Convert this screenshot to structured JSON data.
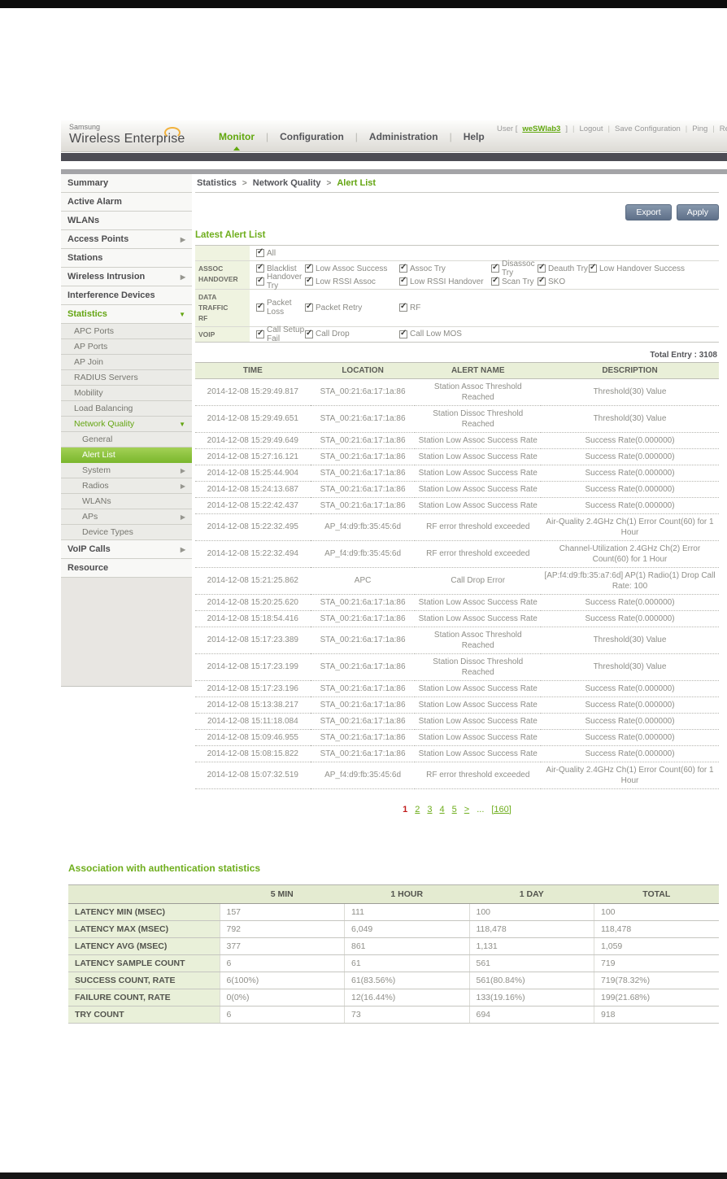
{
  "brand": {
    "company": "Samsung",
    "product": "Wireless Enterprise"
  },
  "topbar": {
    "user_prefix": "User [",
    "username": "weSWlab3",
    "user_suffix": "]",
    "separator": "|",
    "links": [
      "Logout",
      "Save Configuration",
      "Ping",
      "Refresh"
    ]
  },
  "nav": {
    "separator": "|",
    "items": [
      {
        "label": "Monitor",
        "active": true
      },
      {
        "label": "Configuration",
        "active": false
      },
      {
        "label": "Administration",
        "active": false
      },
      {
        "label": "Help",
        "active": false
      }
    ]
  },
  "sidebar": {
    "items": [
      {
        "label": "Summary",
        "level": 0
      },
      {
        "label": "Active Alarm",
        "level": 0
      },
      {
        "label": "WLANs",
        "level": 0
      },
      {
        "label": "Access Points",
        "level": 0,
        "arrow": "right"
      },
      {
        "label": "Stations",
        "level": 0
      },
      {
        "label": "Wireless Intrusion",
        "level": 0,
        "arrow": "right"
      },
      {
        "label": "Interference Devices",
        "level": 0
      },
      {
        "label": "Statistics",
        "level": 0,
        "arrow": "down",
        "green": true
      },
      {
        "label": "APC Ports",
        "level": 1
      },
      {
        "label": "AP Ports",
        "level": 1
      },
      {
        "label": "AP Join",
        "level": 1
      },
      {
        "label": "RADIUS Servers",
        "level": 1
      },
      {
        "label": "Mobility",
        "level": 1
      },
      {
        "label": "Load Balancing",
        "level": 1
      },
      {
        "label": "Network Quality",
        "level": 1,
        "arrow": "down",
        "green": true
      },
      {
        "label": "General",
        "level": 2
      },
      {
        "label": "Alert List",
        "level": 2,
        "selected": true
      },
      {
        "label": "System",
        "level": 2,
        "arrow": "right"
      },
      {
        "label": "Radios",
        "level": 2,
        "arrow": "right"
      },
      {
        "label": "WLANs",
        "level": 2
      },
      {
        "label": "APs",
        "level": 2,
        "arrow": "right"
      },
      {
        "label": "Device Types",
        "level": 2
      },
      {
        "label": "VoIP Calls",
        "level": 0,
        "arrow": "right"
      },
      {
        "label": "Resource",
        "level": 0
      }
    ]
  },
  "breadcrumb": {
    "separator": ">",
    "items": [
      "Statistics",
      "Network Quality",
      "Alert List"
    ]
  },
  "actions": {
    "export_label": "Export",
    "apply_label": "Apply"
  },
  "alerts": {
    "title": "Latest Alert List",
    "total_entry": "Total Entry : 3108",
    "filters": {
      "all_checked": true,
      "rows": [
        {
          "label_lines": [],
          "lines": [
            [
              "All"
            ]
          ]
        },
        {
          "label_lines": [
            "ASSOC",
            "HANDOVER"
          ],
          "lines": [
            [
              "Blacklist",
              "Low Assoc Success",
              "Assoc Try",
              "Disassoc Try",
              "Deauth Try",
              "Low Handover Success"
            ],
            [
              "Handover Try",
              "Low RSSI Assoc",
              "Low RSSI Handover",
              "Scan Try",
              "SKO"
            ]
          ]
        },
        {
          "label_lines": [
            "DATA TRAFFIC",
            "RF"
          ],
          "lines": [
            [
              "Packet Loss",
              "Packet Retry",
              "RF"
            ]
          ]
        },
        {
          "label_lines": [
            "VOIP"
          ],
          "lines": [
            [
              "Call Setup Fail",
              "Call Drop",
              "Call Low MOS"
            ]
          ]
        }
      ]
    },
    "table": {
      "columns": [
        "TIME",
        "LOCATION",
        "ALERT NAME",
        "DESCRIPTION"
      ],
      "rows": [
        [
          "2014-12-08 15:29:49.817",
          "STA_00:21:6a:17:1a:86",
          "Station Assoc Threshold Reached",
          "Threshold(30) Value"
        ],
        [
          "2014-12-08 15:29:49.651",
          "STA_00:21:6a:17:1a:86",
          "Station Dissoc Threshold Reached",
          "Threshold(30) Value"
        ],
        [
          "2014-12-08 15:29:49.649",
          "STA_00:21:6a:17:1a:86",
          "Station Low Assoc Success Rate",
          "Success Rate(0.000000)"
        ],
        [
          "2014-12-08 15:27:16.121",
          "STA_00:21:6a:17:1a:86",
          "Station Low Assoc Success Rate",
          "Success Rate(0.000000)"
        ],
        [
          "2014-12-08 15:25:44.904",
          "STA_00:21:6a:17:1a:86",
          "Station Low Assoc Success Rate",
          "Success Rate(0.000000)"
        ],
        [
          "2014-12-08 15:24:13.687",
          "STA_00:21:6a:17:1a:86",
          "Station Low Assoc Success Rate",
          "Success Rate(0.000000)"
        ],
        [
          "2014-12-08 15:22:42.437",
          "STA_00:21:6a:17:1a:86",
          "Station Low Assoc Success Rate",
          "Success Rate(0.000000)"
        ],
        [
          "2014-12-08 15:22:32.495",
          "AP_f4:d9:fb:35:45:6d",
          "RF error threshold exceeded",
          "Air-Quality 2.4GHz Ch(1) Error Count(60) for 1 Hour"
        ],
        [
          "2014-12-08 15:22:32.494",
          "AP_f4:d9:fb:35:45:6d",
          "RF error threshold exceeded",
          "Channel-Utilization 2.4GHz Ch(2) Error Count(60) for 1 Hour"
        ],
        [
          "2014-12-08 15:21:25.862",
          "APC",
          "Call Drop Error",
          "[AP:f4:d9:fb:35:a7:6d] AP(1) Radio(1) Drop Call Rate: 100"
        ],
        [
          "2014-12-08 15:20:25.620",
          "STA_00:21:6a:17:1a:86",
          "Station Low Assoc Success Rate",
          "Success Rate(0.000000)"
        ],
        [
          "2014-12-08 15:18:54.416",
          "STA_00:21:6a:17:1a:86",
          "Station Low Assoc Success Rate",
          "Success Rate(0.000000)"
        ],
        [
          "2014-12-08 15:17:23.389",
          "STA_00:21:6a:17:1a:86",
          "Station Assoc Threshold Reached",
          "Threshold(30) Value"
        ],
        [
          "2014-12-08 15:17:23.199",
          "STA_00:21:6a:17:1a:86",
          "Station Dissoc Threshold Reached",
          "Threshold(30) Value"
        ],
        [
          "2014-12-08 15:17:23.196",
          "STA_00:21:6a:17:1a:86",
          "Station Low Assoc Success Rate",
          "Success Rate(0.000000)"
        ],
        [
          "2014-12-08 15:13:38.217",
          "STA_00:21:6a:17:1a:86",
          "Station Low Assoc Success Rate",
          "Success Rate(0.000000)"
        ],
        [
          "2014-12-08 15:11:18.084",
          "STA_00:21:6a:17:1a:86",
          "Station Low Assoc Success Rate",
          "Success Rate(0.000000)"
        ],
        [
          "2014-12-08 15:09:46.955",
          "STA_00:21:6a:17:1a:86",
          "Station Low Assoc Success Rate",
          "Success Rate(0.000000)"
        ],
        [
          "2014-12-08 15:08:15.822",
          "STA_00:21:6a:17:1a:86",
          "Station Low Assoc Success Rate",
          "Success Rate(0.000000)"
        ],
        [
          "2014-12-08 15:07:32.519",
          "AP_f4:d9:fb:35:45:6d",
          "RF error threshold exceeded",
          "Air-Quality 2.4GHz Ch(1) Error Count(60) for 1 Hour"
        ]
      ]
    },
    "pagination": {
      "current": "1",
      "pages": [
        "2",
        "3",
        "4",
        "5"
      ],
      "next": ">",
      "ellipsis": "...",
      "last": "[160]"
    }
  },
  "auth_stats": {
    "title": "Association with authentication statistics",
    "columns": [
      "",
      "5 MIN",
      "1 HOUR",
      "1 DAY",
      "TOTAL"
    ],
    "rows": [
      [
        "LATENCY MIN (MSEC)",
        "157",
        "111",
        "100",
        "100"
      ],
      [
        "LATENCY MAX (MSEC)",
        "792",
        "6,049",
        "118,478",
        "118,478"
      ],
      [
        "LATENCY AVG (MSEC)",
        "377",
        "861",
        "1,131",
        "1,059"
      ],
      [
        "LATENCY SAMPLE COUNT",
        "6",
        "61",
        "561",
        "719"
      ],
      [
        "SUCCESS COUNT, RATE",
        "6(100%)",
        "61(83.56%)",
        "561(80.84%)",
        "719(78.32%)"
      ],
      [
        "FAILURE COUNT, RATE",
        "0(0%)",
        "12(16.44%)",
        "133(19.16%)",
        "199(21.68%)"
      ],
      [
        "TRY COUNT",
        "6",
        "73",
        "694",
        "918"
      ]
    ]
  },
  "colors": {
    "accent_green": "#6fae1d",
    "selected_item_green": "#8dc63f",
    "button_slate": "#6e7f96",
    "current_page_red": "#c21d1d"
  }
}
